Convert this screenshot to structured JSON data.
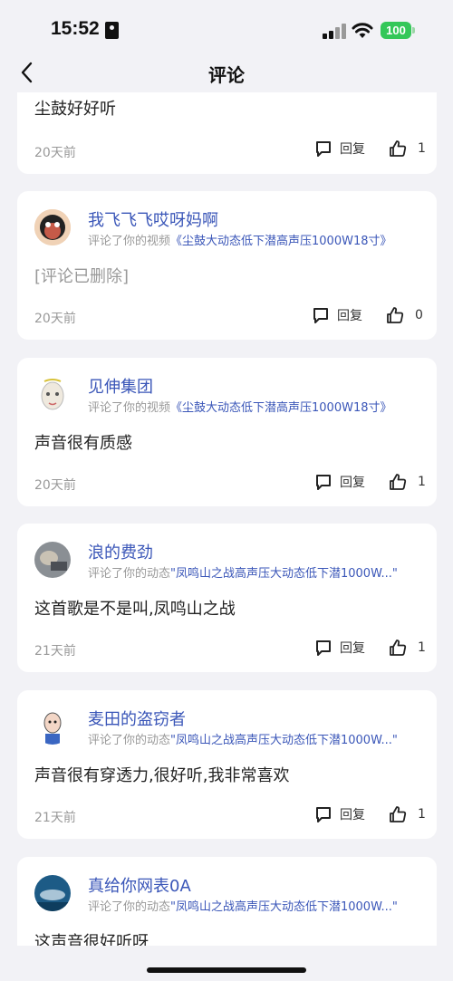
{
  "status": {
    "time": "15:52",
    "battery": "100"
  },
  "header": {
    "title": "评论"
  },
  "colors": {
    "accent": "#3a56b8",
    "background": "#f2f2f6",
    "battery": "#34c759"
  },
  "comments": [
    {
      "user": "",
      "action": "",
      "target": "",
      "text": "尘鼓好好听",
      "deleted": false,
      "time": "20天前",
      "reply_label": "回复",
      "likes": "1",
      "avatar": "none"
    },
    {
      "user": "我飞飞飞哎呀妈啊",
      "action": "评论了你的视频",
      "target": "《尘鼓大动态低下潜高声压1000W18寸》",
      "text": "[评论已删除]",
      "deleted": true,
      "time": "20天前",
      "reply_label": "回复",
      "likes": "0",
      "avatar": "cartoon-face-avatar"
    },
    {
      "user": "见伸集团",
      "action": "评论了你的视频",
      "target": "《尘鼓大动态低下潜高声压1000W18寸》",
      "text": "声音很有质感",
      "deleted": false,
      "time": "20天前",
      "reply_label": "回复",
      "likes": "1",
      "avatar": "mask-face-avatar"
    },
    {
      "user": "浪的费劲",
      "action": "评论了你的动态",
      "target": "\"凤鸣山之战高声压大动态低下潜1000W...\"",
      "text": "这首歌是不是叫,凤鸣山之战",
      "deleted": false,
      "time": "21天前",
      "reply_label": "回复",
      "likes": "1",
      "avatar": "photo-avatar"
    },
    {
      "user": "麦田的盗窃者",
      "action": "评论了你的动态",
      "target": "\"凤鸣山之战高声压大动态低下潜1000W...\"",
      "text": "声音很有穿透力,很好听,我非常喜欢",
      "deleted": false,
      "time": "21天前",
      "reply_label": "回复",
      "likes": "1",
      "avatar": "caricature-avatar"
    },
    {
      "user": "真给你网表0A",
      "action": "评论了你的动态",
      "target": "\"凤鸣山之战高声压大动态低下潜1000W...\"",
      "text": "这声音很好听呀",
      "deleted": false,
      "time": "",
      "reply_label": "",
      "likes": "",
      "avatar": "whale-avatar"
    }
  ]
}
